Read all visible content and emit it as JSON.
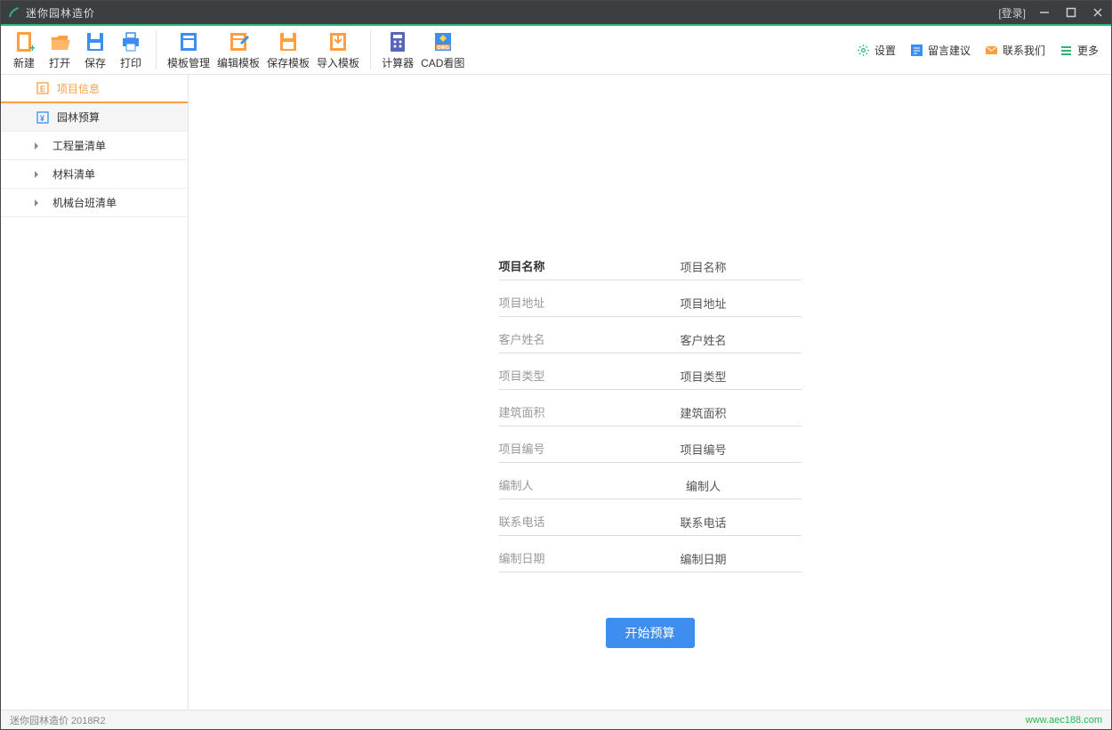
{
  "title": "迷你园林造价",
  "login_text": "[登录]",
  "toolbar": {
    "new": "新建",
    "open": "打开",
    "save": "保存",
    "print": "打印",
    "tpl_manage": "模板管理",
    "tpl_edit": "编辑模板",
    "tpl_save": "保存模板",
    "tpl_import": "导入模板",
    "calc": "计算器",
    "cad": "CAD看图"
  },
  "rightbar": {
    "settings": "设置",
    "feedback": "留言建议",
    "contact": "联系我们",
    "more": "更多"
  },
  "sidebar": {
    "items": [
      {
        "label": "项目信息",
        "type": "level1",
        "active": true,
        "icon": "doc"
      },
      {
        "label": "园林预算",
        "type": "level1",
        "selected": true,
        "icon": "yen"
      },
      {
        "label": "工程量清单",
        "type": "level2"
      },
      {
        "label": "材料清单",
        "type": "level2"
      },
      {
        "label": "机械台班清单",
        "type": "level2"
      }
    ]
  },
  "form": {
    "fields": [
      {
        "label": "项目名称",
        "placeholder": "项目名称",
        "bold": true
      },
      {
        "label": "项目地址",
        "placeholder": "项目地址"
      },
      {
        "label": "客户姓名",
        "placeholder": "客户姓名"
      },
      {
        "label": "项目类型",
        "placeholder": "项目类型"
      },
      {
        "label": "建筑面积",
        "placeholder": "建筑面积"
      },
      {
        "label": "项目编号",
        "placeholder": "项目编号"
      },
      {
        "label": "编制人",
        "placeholder": "编制人"
      },
      {
        "label": "联系电话",
        "placeholder": "联系电话"
      },
      {
        "label": "编制日期",
        "placeholder": "编制日期"
      }
    ],
    "start_button": "开始预算"
  },
  "statusbar": {
    "version": "迷你园林造价 2018R2",
    "url": "www.aec188.com"
  },
  "colors": {
    "accent_green": "#2bb673",
    "accent_orange": "#ff9f40",
    "primary_blue": "#3e8ef0"
  }
}
